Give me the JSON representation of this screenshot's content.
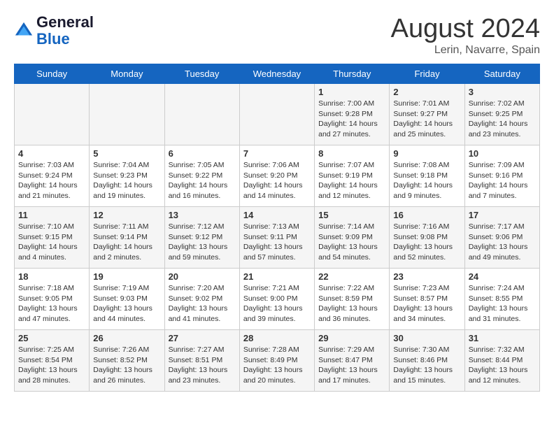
{
  "header": {
    "logo_line1": "General",
    "logo_line2": "Blue",
    "month_year": "August 2024",
    "location": "Lerin, Navarre, Spain"
  },
  "weekdays": [
    "Sunday",
    "Monday",
    "Tuesday",
    "Wednesday",
    "Thursday",
    "Friday",
    "Saturday"
  ],
  "weeks": [
    [
      {
        "day": "",
        "info": ""
      },
      {
        "day": "",
        "info": ""
      },
      {
        "day": "",
        "info": ""
      },
      {
        "day": "",
        "info": ""
      },
      {
        "day": "1",
        "info": "Sunrise: 7:00 AM\nSunset: 9:28 PM\nDaylight: 14 hours\nand 27 minutes."
      },
      {
        "day": "2",
        "info": "Sunrise: 7:01 AM\nSunset: 9:27 PM\nDaylight: 14 hours\nand 25 minutes."
      },
      {
        "day": "3",
        "info": "Sunrise: 7:02 AM\nSunset: 9:25 PM\nDaylight: 14 hours\nand 23 minutes."
      }
    ],
    [
      {
        "day": "4",
        "info": "Sunrise: 7:03 AM\nSunset: 9:24 PM\nDaylight: 14 hours\nand 21 minutes."
      },
      {
        "day": "5",
        "info": "Sunrise: 7:04 AM\nSunset: 9:23 PM\nDaylight: 14 hours\nand 19 minutes."
      },
      {
        "day": "6",
        "info": "Sunrise: 7:05 AM\nSunset: 9:22 PM\nDaylight: 14 hours\nand 16 minutes."
      },
      {
        "day": "7",
        "info": "Sunrise: 7:06 AM\nSunset: 9:20 PM\nDaylight: 14 hours\nand 14 minutes."
      },
      {
        "day": "8",
        "info": "Sunrise: 7:07 AM\nSunset: 9:19 PM\nDaylight: 14 hours\nand 12 minutes."
      },
      {
        "day": "9",
        "info": "Sunrise: 7:08 AM\nSunset: 9:18 PM\nDaylight: 14 hours\nand 9 minutes."
      },
      {
        "day": "10",
        "info": "Sunrise: 7:09 AM\nSunset: 9:16 PM\nDaylight: 14 hours\nand 7 minutes."
      }
    ],
    [
      {
        "day": "11",
        "info": "Sunrise: 7:10 AM\nSunset: 9:15 PM\nDaylight: 14 hours\nand 4 minutes."
      },
      {
        "day": "12",
        "info": "Sunrise: 7:11 AM\nSunset: 9:14 PM\nDaylight: 14 hours\nand 2 minutes."
      },
      {
        "day": "13",
        "info": "Sunrise: 7:12 AM\nSunset: 9:12 PM\nDaylight: 13 hours\nand 59 minutes."
      },
      {
        "day": "14",
        "info": "Sunrise: 7:13 AM\nSunset: 9:11 PM\nDaylight: 13 hours\nand 57 minutes."
      },
      {
        "day": "15",
        "info": "Sunrise: 7:14 AM\nSunset: 9:09 PM\nDaylight: 13 hours\nand 54 minutes."
      },
      {
        "day": "16",
        "info": "Sunrise: 7:16 AM\nSunset: 9:08 PM\nDaylight: 13 hours\nand 52 minutes."
      },
      {
        "day": "17",
        "info": "Sunrise: 7:17 AM\nSunset: 9:06 PM\nDaylight: 13 hours\nand 49 minutes."
      }
    ],
    [
      {
        "day": "18",
        "info": "Sunrise: 7:18 AM\nSunset: 9:05 PM\nDaylight: 13 hours\nand 47 minutes."
      },
      {
        "day": "19",
        "info": "Sunrise: 7:19 AM\nSunset: 9:03 PM\nDaylight: 13 hours\nand 44 minutes."
      },
      {
        "day": "20",
        "info": "Sunrise: 7:20 AM\nSunset: 9:02 PM\nDaylight: 13 hours\nand 41 minutes."
      },
      {
        "day": "21",
        "info": "Sunrise: 7:21 AM\nSunset: 9:00 PM\nDaylight: 13 hours\nand 39 minutes."
      },
      {
        "day": "22",
        "info": "Sunrise: 7:22 AM\nSunset: 8:59 PM\nDaylight: 13 hours\nand 36 minutes."
      },
      {
        "day": "23",
        "info": "Sunrise: 7:23 AM\nSunset: 8:57 PM\nDaylight: 13 hours\nand 34 minutes."
      },
      {
        "day": "24",
        "info": "Sunrise: 7:24 AM\nSunset: 8:55 PM\nDaylight: 13 hours\nand 31 minutes."
      }
    ],
    [
      {
        "day": "25",
        "info": "Sunrise: 7:25 AM\nSunset: 8:54 PM\nDaylight: 13 hours\nand 28 minutes."
      },
      {
        "day": "26",
        "info": "Sunrise: 7:26 AM\nSunset: 8:52 PM\nDaylight: 13 hours\nand 26 minutes."
      },
      {
        "day": "27",
        "info": "Sunrise: 7:27 AM\nSunset: 8:51 PM\nDaylight: 13 hours\nand 23 minutes."
      },
      {
        "day": "28",
        "info": "Sunrise: 7:28 AM\nSunset: 8:49 PM\nDaylight: 13 hours\nand 20 minutes."
      },
      {
        "day": "29",
        "info": "Sunrise: 7:29 AM\nSunset: 8:47 PM\nDaylight: 13 hours\nand 17 minutes."
      },
      {
        "day": "30",
        "info": "Sunrise: 7:30 AM\nSunset: 8:46 PM\nDaylight: 13 hours\nand 15 minutes."
      },
      {
        "day": "31",
        "info": "Sunrise: 7:32 AM\nSunset: 8:44 PM\nDaylight: 13 hours\nand 12 minutes."
      }
    ]
  ]
}
